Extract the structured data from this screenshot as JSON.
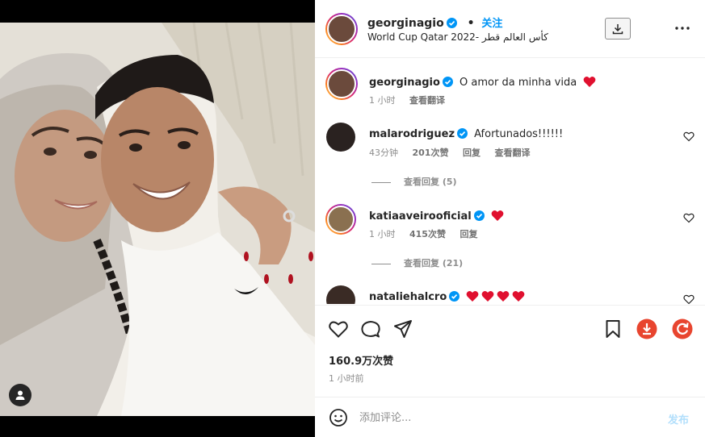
{
  "post": {
    "author": "georginagio",
    "follow_label": "关注",
    "location": "World Cup Qatar 2022- كأس العالم قطر",
    "caption": "O amor da minha vida",
    "caption_time": "1 小时",
    "caption_translate": "查看翻译",
    "likes": "160.9万次赞",
    "time_ago": "1 小时前"
  },
  "comments": [
    {
      "user": "malarodriguez",
      "text": "Afortunados!!!!!!",
      "time": "43分钟",
      "likes": "201次赞",
      "reply_label": "回复",
      "translate_label": "查看翻译",
      "view_replies": "查看回复 (5)"
    },
    {
      "user": "katiaaveirooficial",
      "text": "",
      "time": "1 小时",
      "likes": "415次赞",
      "reply_label": "回复",
      "view_replies": "查看回复 (21)"
    },
    {
      "user": "nataliehalcro",
      "text": ""
    }
  ],
  "composer": {
    "placeholder": "添加评论...",
    "post_label": "发布"
  },
  "icons": {
    "verified": "verified-badge-icon",
    "heart_emoji": "red-heart-emoji",
    "like": "heart-outline-icon",
    "comment": "comment-icon",
    "share": "paper-plane-icon",
    "save": "bookmark-icon",
    "download_ext": "download-extension-icon",
    "refresh_ext": "refresh-extension-icon",
    "emoji": "smiley-icon",
    "more": "more-horizontal-icon",
    "download": "download-icon",
    "user_tag": "user-tag-icon"
  },
  "colors": {
    "verified": "#0095f6",
    "link": "#0095f6",
    "heart": "#e0102f",
    "post_disabled": "#b2dffc",
    "ext_red": "#e8452f"
  }
}
